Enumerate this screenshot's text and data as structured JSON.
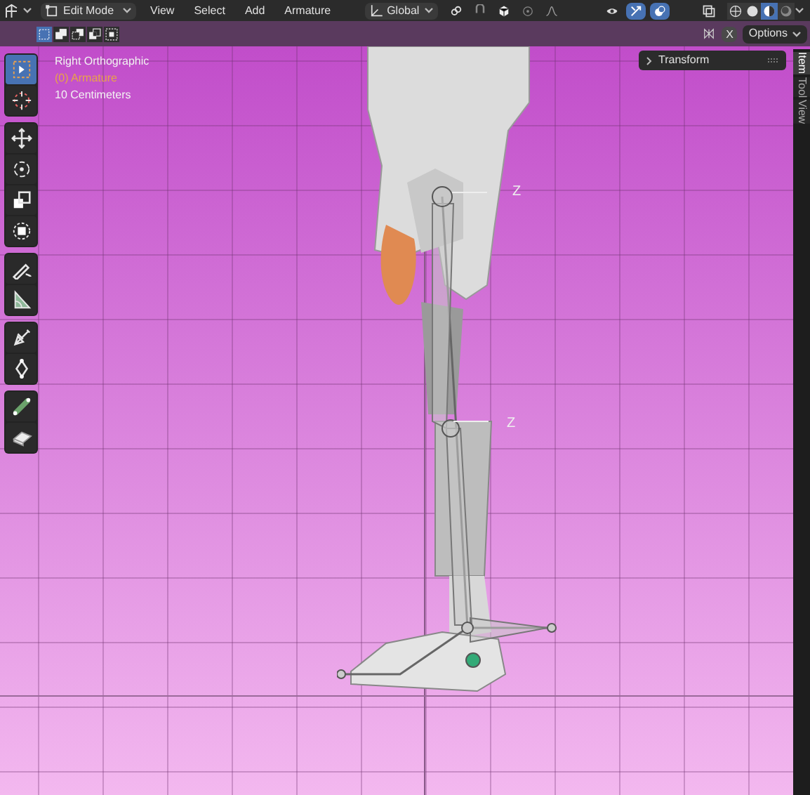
{
  "header": {
    "mode": "Edit Mode",
    "menus": [
      "View",
      "Select",
      "Add",
      "Armature"
    ],
    "orientation": "Global",
    "toggles": [
      {
        "kind": "link",
        "selected": false
      },
      {
        "kind": "magnet",
        "selected": false
      },
      {
        "kind": "cube",
        "selected": false
      },
      {
        "kind": "target",
        "selected": false
      },
      {
        "kind": "falloff",
        "selected": false
      },
      {
        "kind": "eye",
        "selected": false
      },
      {
        "kind": "gizmo",
        "selected": true
      },
      {
        "kind": "overlay",
        "selected": true
      },
      {
        "kind": "xray",
        "selected": false
      }
    ],
    "shading": [
      {
        "kind": "wire",
        "selected": false
      },
      {
        "kind": "solid",
        "selected": false
      },
      {
        "kind": "material",
        "selected": true
      },
      {
        "kind": "render",
        "selected": false
      }
    ]
  },
  "subheader": {
    "select_modes": [
      {
        "kind": "new",
        "selected": true
      },
      {
        "kind": "extend",
        "selected": false
      },
      {
        "kind": "subtract",
        "selected": false
      },
      {
        "kind": "invert",
        "selected": false
      },
      {
        "kind": "intersect",
        "selected": false
      }
    ],
    "axis_label": "X",
    "options": "Options"
  },
  "viewport": {
    "overlay_text": [
      {
        "text": "Right Orthographic",
        "kind": "view"
      },
      {
        "text": "(0) Armature",
        "kind": "object"
      },
      {
        "text": "10 Centimeters",
        "kind": "scale"
      }
    ],
    "axis_labels": [
      "Z",
      "Z"
    ]
  },
  "toolbar": [
    [
      {
        "kind": "select",
        "selected": true
      },
      {
        "kind": "cursor",
        "selected": false
      }
    ],
    [
      {
        "kind": "move",
        "selected": false
      },
      {
        "kind": "rotate",
        "selected": false
      },
      {
        "kind": "scale",
        "selected": false
      },
      {
        "kind": "transform",
        "selected": false
      }
    ],
    [
      {
        "kind": "annotate",
        "selected": false
      },
      {
        "kind": "measure",
        "selected": false
      }
    ],
    [
      {
        "kind": "roll",
        "selected": false
      },
      {
        "kind": "envelope",
        "selected": false
      }
    ],
    [
      {
        "kind": "extrude",
        "selected": false
      },
      {
        "kind": "shear",
        "selected": false
      }
    ]
  ],
  "sidebar": {
    "panel": "Transform",
    "tabs": [
      {
        "label": "Item",
        "selected": true
      },
      {
        "label": "Tool",
        "selected": false
      },
      {
        "label": "View",
        "selected": false
      }
    ]
  }
}
